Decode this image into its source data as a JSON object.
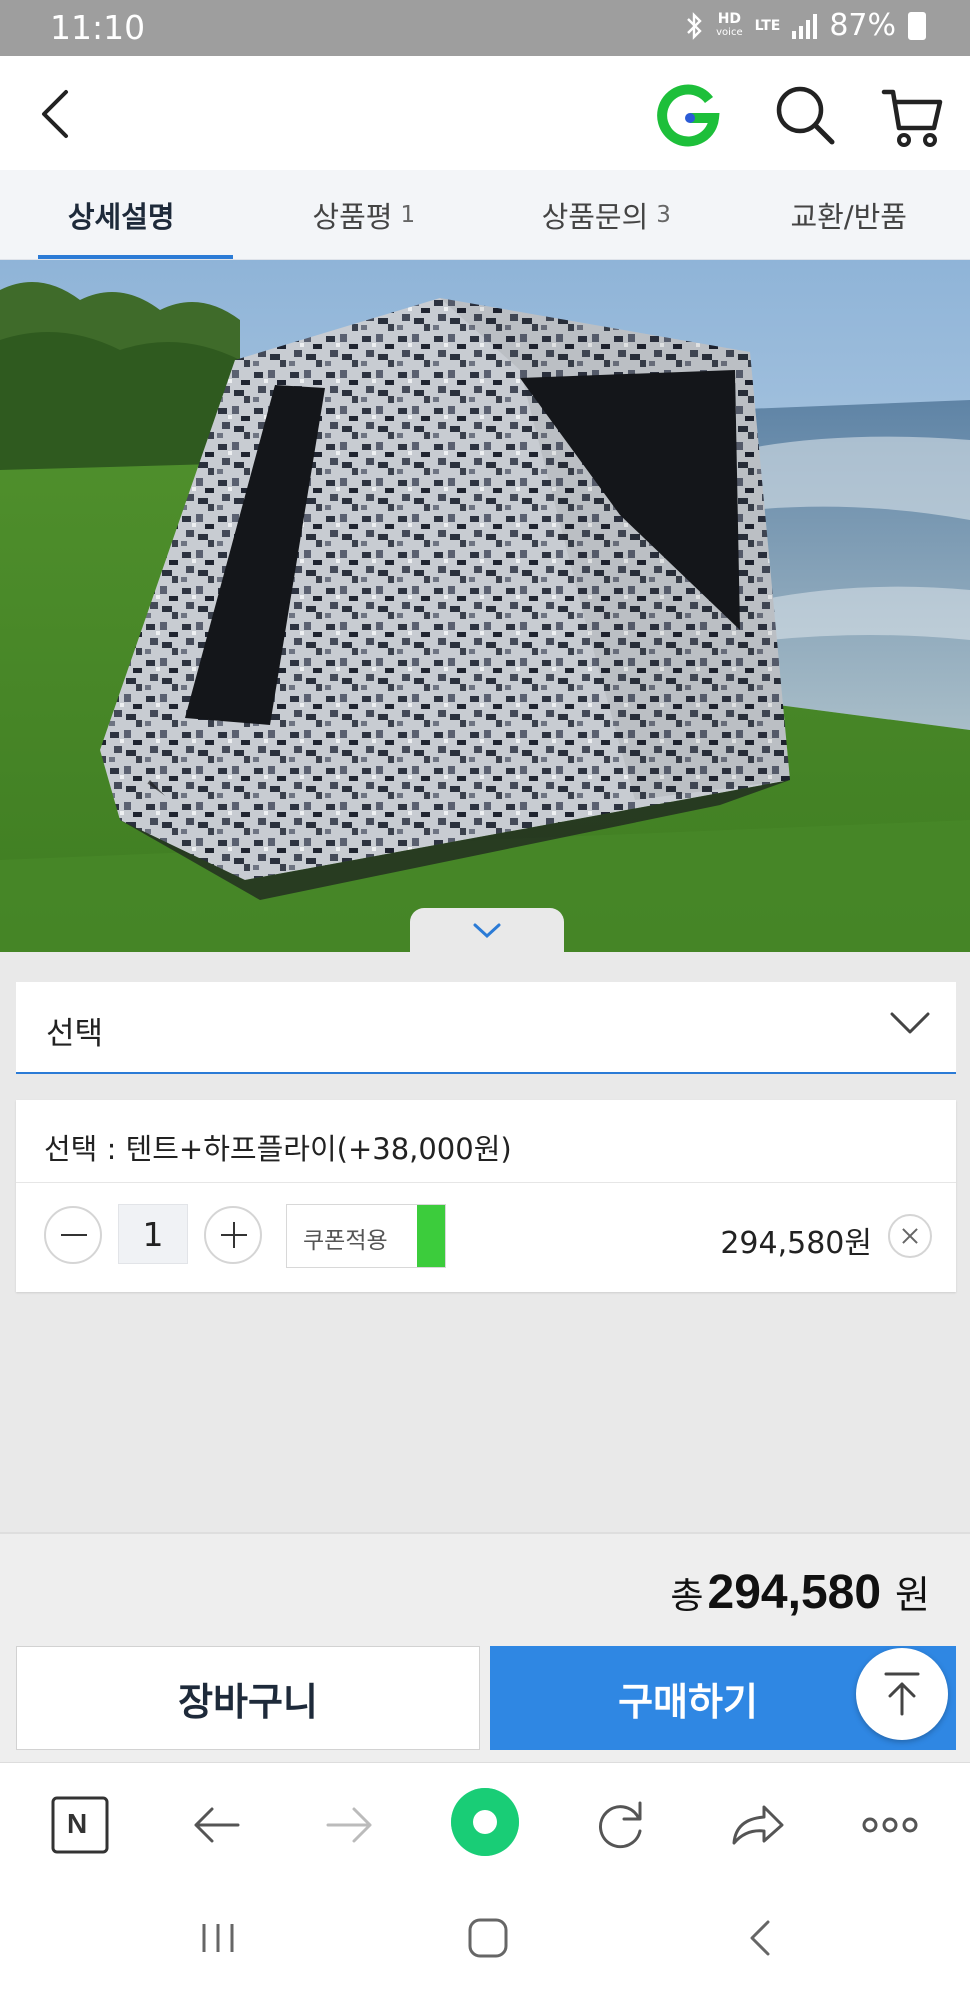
{
  "status": {
    "time": "11:10",
    "hd_top": "HD",
    "hd_bottom": "voice",
    "network": "LTE",
    "battery": "87%"
  },
  "header": {
    "back_icon": "chevron-left-icon",
    "logo_letter": "G",
    "search_icon": "search-icon",
    "cart_icon": "cart-icon",
    "brand_color": "#1dbf3a"
  },
  "tabs": [
    {
      "label": "상세설명",
      "count": ""
    },
    {
      "label": "상품평",
      "count": "1"
    },
    {
      "label": "상품문의",
      "count": "3"
    },
    {
      "label": "교환/반품",
      "count": ""
    }
  ],
  "option_select": {
    "label": "선택"
  },
  "selected_option": {
    "title": "선택 : 텐트+하프플라이(+38,000원)",
    "quantity": "1",
    "coupon_label": "쿠폰적용",
    "price": "294,580원"
  },
  "total": {
    "prefix": "총",
    "amount": "294,580",
    "unit": "원"
  },
  "actions": {
    "cart_label": "장바구니",
    "buy_label": "구매하기",
    "accent": "#2f87e3"
  },
  "browser_toolbar": {
    "tab_letter": "N"
  },
  "colors": {
    "accent_blue": "#2b7bd6",
    "coupon_green": "#3ccc3c",
    "naver_green": "#1fd1a0"
  }
}
